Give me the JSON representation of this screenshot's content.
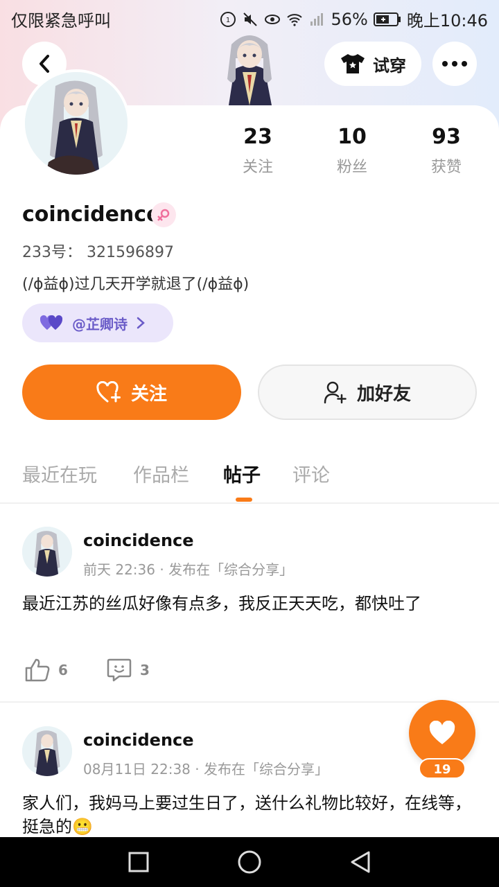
{
  "status_bar": {
    "carrier": "仅限紧急呼叫",
    "battery": "56%",
    "time": "晚上10:46"
  },
  "header": {
    "try_on_label": "试穿"
  },
  "stats": [
    {
      "value": "23",
      "label": "关注"
    },
    {
      "value": "10",
      "label": "粉丝"
    },
    {
      "value": "93",
      "label": "获赞"
    }
  ],
  "profile": {
    "username": "coincidence",
    "uid": "233号： 321596897",
    "bio": "(/ɸ益ɸ)过几天开学就退了(/ɸ益ɸ)",
    "cp_tag": "@芷卿诗"
  },
  "buttons": {
    "follow": "关注",
    "add_friend": "加好友"
  },
  "tabs": [
    {
      "label": "最近在玩",
      "active": false
    },
    {
      "label": "作品栏",
      "active": false
    },
    {
      "label": "帖子",
      "active": true
    },
    {
      "label": "评论",
      "active": false
    }
  ],
  "posts": [
    {
      "author": "coincidence",
      "meta": "前天 22:36 · 发布在「综合分享」",
      "text": "最近江苏的丝瓜好像有点多，我反正天天吃，都快吐了",
      "likes": "6",
      "comments": "3"
    },
    {
      "author": "coincidence",
      "meta": "08月11日 22:38 · 发布在「综合分享」",
      "text": "家人们，我妈马上要过生日了，送什么礼物比较好，在线等，挺急的😬"
    }
  ],
  "fab": {
    "count": "19"
  },
  "colors": {
    "accent": "#f97b18",
    "cp_tag_bg": "#ebe6fb",
    "cp_tag_text": "#6a5bc8"
  }
}
